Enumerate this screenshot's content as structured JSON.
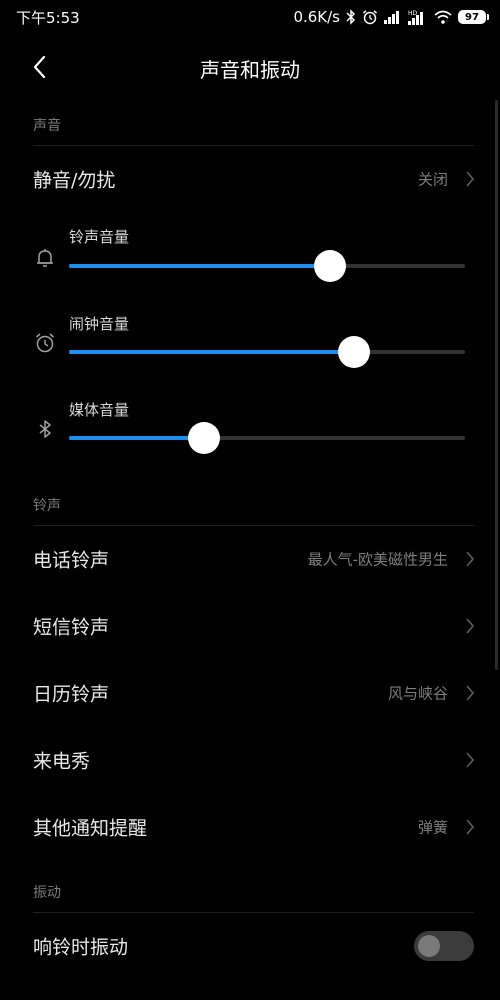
{
  "status_bar": {
    "time": "下午5:53",
    "net_speed": "0.6K/s",
    "battery": "97",
    "icons": [
      "bluetooth-icon",
      "alarm-icon",
      "signal-icon",
      "hd-signal-icon",
      "wifi-icon",
      "battery-icon"
    ]
  },
  "header": {
    "title": "声音和振动",
    "back_icon": "back-arrow-icon"
  },
  "sections": {
    "sound": {
      "title": "声音",
      "mute": {
        "label": "静音/勿扰",
        "value": "关闭"
      },
      "sliders": [
        {
          "label": "铃声音量",
          "icon": "bell-icon",
          "level": 0.66
        },
        {
          "label": "闹钟音量",
          "icon": "alarm-clock-icon",
          "level": 0.72
        },
        {
          "label": "媒体音量",
          "icon": "bluetooth-icon",
          "level": 0.34
        }
      ]
    },
    "ringtone": {
      "title": "铃声",
      "items": [
        {
          "label": "电话铃声",
          "value": "最人气-欧美磁性男生"
        },
        {
          "label": "短信铃声",
          "value": ""
        },
        {
          "label": "日历铃声",
          "value": "风与峡谷"
        },
        {
          "label": "来电秀",
          "value": ""
        },
        {
          "label": "其他通知提醒",
          "value": "弹簧"
        }
      ]
    },
    "vibration": {
      "title": "振动",
      "items": [
        {
          "label": "响铃时振动",
          "toggle_on": false
        }
      ]
    }
  },
  "colors": {
    "background": "#000000",
    "accent": "#1a8ff0",
    "secondary_text": "#7d7d7d"
  }
}
